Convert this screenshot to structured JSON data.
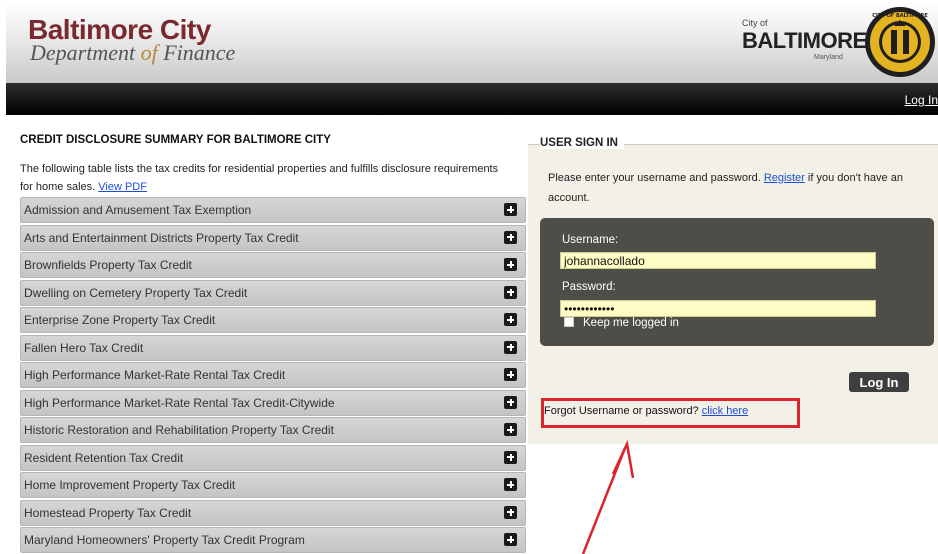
{
  "header": {
    "logo_line1": "Baltimore City",
    "logo_dept": "Department",
    "logo_of": "of",
    "logo_finance": "Finance",
    "city_small": "City of",
    "city_big": "BALTIMORE",
    "city_state": "Maryland",
    "seal_text": "CITY OF BALTIMORE"
  },
  "nav": {
    "login_link": "Log In"
  },
  "left": {
    "title": "CREDIT DISCLOSURE SUMMARY FOR BALTIMORE CITY",
    "intro": "The following table lists the tax credits for residential properties and fulfills disclosure requirements for home sales.",
    "view_pdf": "View PDF",
    "credits": [
      "Admission and Amusement Tax Exemption",
      "Arts and Entertainment Districts Property Tax Credit",
      "Brownfields Property Tax Credit",
      "Dwelling on Cemetery Property Tax Credit",
      "Enterprise Zone Property Tax Credit",
      "Fallen Hero Tax Credit",
      "High Performance Market-Rate Rental Tax Credit",
      "High Performance Market-Rate Rental Tax Credit-Citywide",
      "Historic Restoration and Rehabilitation Property Tax Credit",
      "Resident Retention Tax Credit",
      "Home Improvement Property Tax Credit",
      "Homestead Property Tax Credit",
      "Maryland Homeowners' Property Tax Credit Program"
    ]
  },
  "signin": {
    "title": "USER SIGN IN",
    "msg_before": "Please enter your username and password.",
    "register": "Register",
    "msg_after": "if you don't have an account.",
    "username_label": "Username:",
    "username_value": "johannacollado",
    "password_label": "Password:",
    "password_value": "••••••••••••",
    "keep_logged_in": "Keep me logged in",
    "login_button": "Log In",
    "forgot_text": "Forgot Username or password?",
    "forgot_link": "click here"
  },
  "colors": {
    "logo_red": "#7a2a2e",
    "highlight": "#d9232d",
    "link": "#1a4fd6",
    "input_bg": "#fffbc4"
  }
}
